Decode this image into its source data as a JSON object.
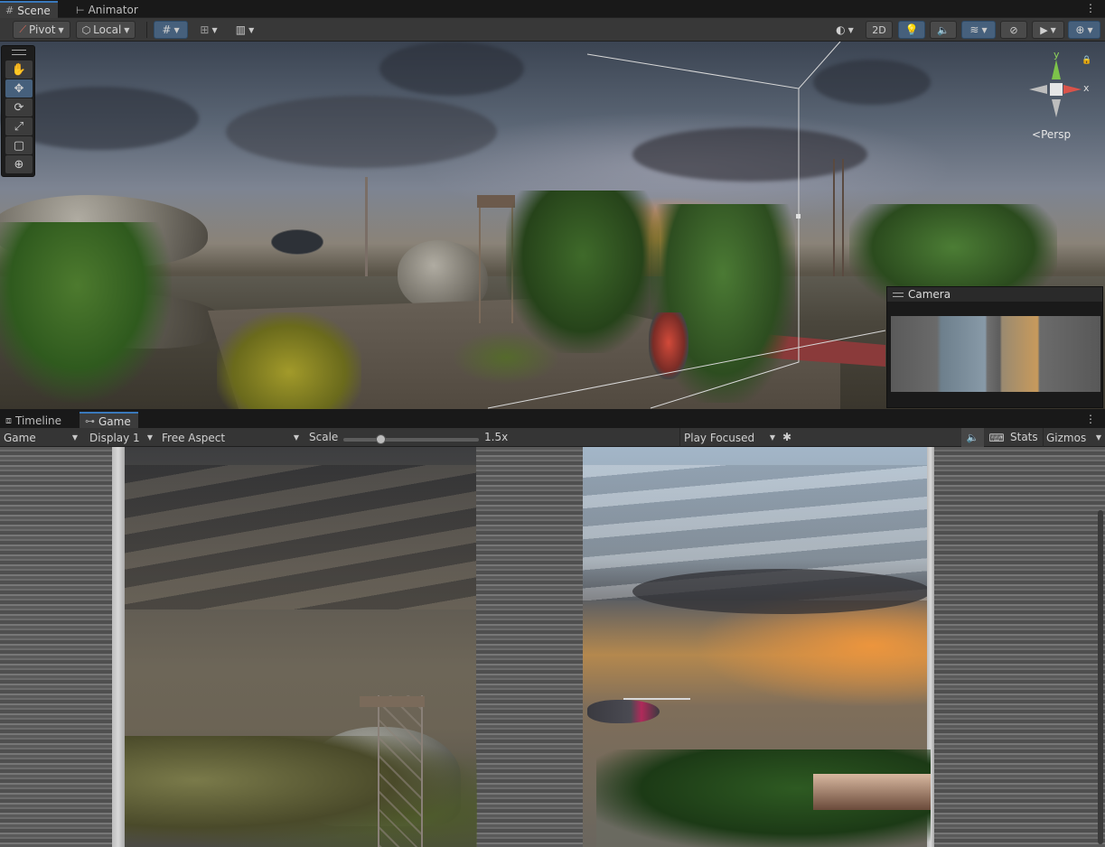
{
  "top_tabs": [
    {
      "label": "Scene",
      "icon": "grid-icon",
      "active": true
    },
    {
      "label": "Animator",
      "icon": "animator-icon",
      "active": false
    }
  ],
  "scene_toolbar": {
    "pivot_label": "Pivot",
    "local_label": "Local",
    "mode_2d_label": "2D"
  },
  "tools": [
    {
      "name": "hand-tool",
      "glyph": "✋"
    },
    {
      "name": "move-tool",
      "glyph": "✥"
    },
    {
      "name": "rotate-tool",
      "glyph": "⟳"
    },
    {
      "name": "scale-tool",
      "glyph": "⤢"
    },
    {
      "name": "rect-tool",
      "glyph": "▢"
    },
    {
      "name": "transform-tool",
      "glyph": "⊕"
    }
  ],
  "gizmo": {
    "y_label": "y",
    "x_label": "x",
    "projection_label": "Persp"
  },
  "camera_preview": {
    "title": "Camera"
  },
  "bottom_tabs": [
    {
      "label": "Timeline",
      "icon": "timeline-icon",
      "active": false
    },
    {
      "label": "Game",
      "icon": "gamepad-icon",
      "active": true
    }
  ],
  "game_toolbar": {
    "view_select": "Game",
    "display_select": "Display 1",
    "aspect_select": "Free Aspect",
    "scale_label": "Scale",
    "scale_value": "1.5x",
    "scale_fraction": 0.26,
    "play_mode_select": "Play Focused",
    "stats_label": "Stats",
    "gizmos_label": "Gizmos"
  },
  "colors": {
    "accent": "#3a79bb",
    "active_button": "#46607c",
    "toolbar_bg": "#383838",
    "tab_bg": "#191919"
  }
}
